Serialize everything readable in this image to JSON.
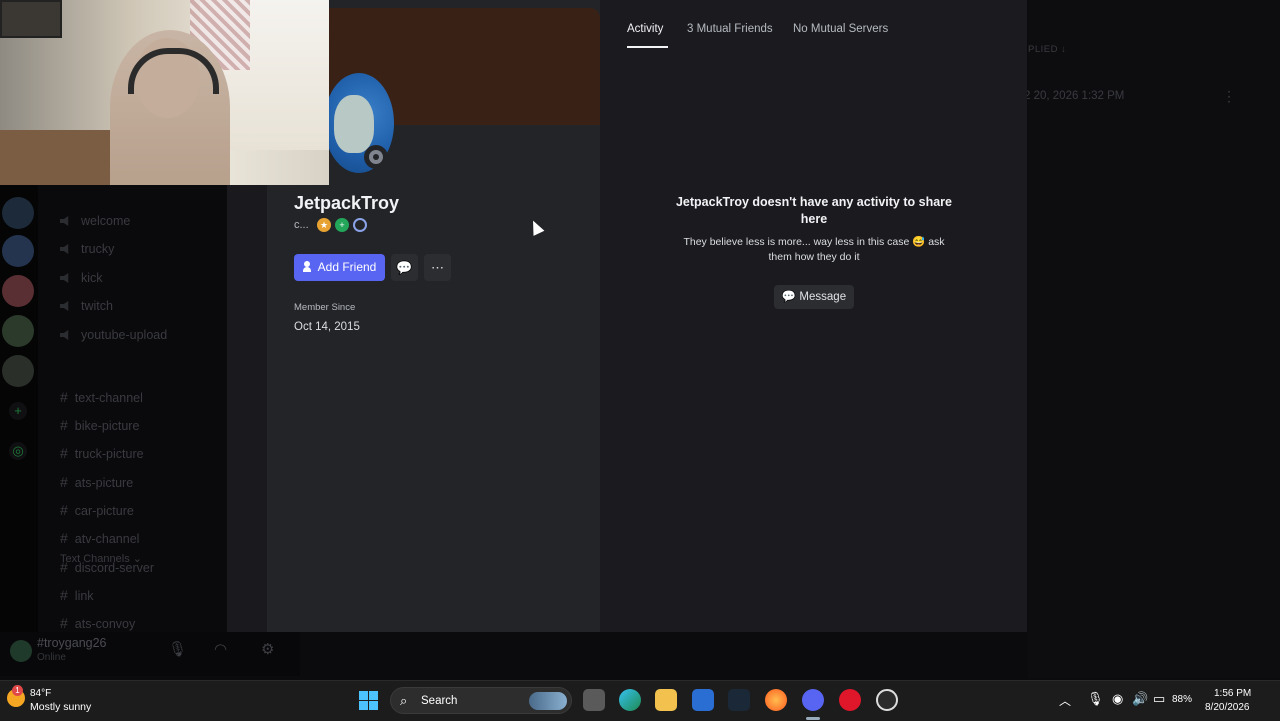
{
  "channels": {
    "voice": [
      "welcome",
      "trucky",
      "kick",
      "twitch",
      "youtube-upload"
    ],
    "category": "Text Channels",
    "text": [
      "text-channel",
      "bike-picture",
      "truck-picture",
      "ats-picture",
      "car-picture",
      "atv-channel",
      "discord-server",
      "link",
      "ats-convoy"
    ]
  },
  "userbar": {
    "name": "#troygang26",
    "status": "Online"
  },
  "background": {
    "replied_label": "PLIED",
    "message_date": "2 20, 2026 1:32 PM"
  },
  "profile": {
    "display_name": "JetpackTroy",
    "custom_status": "c...",
    "add_friend_label": "Add Friend",
    "member_since_label": "Member Since",
    "member_since_date": "Oct 14, 2015",
    "more_icon": "more-horizontal-icon",
    "status_color": "#80848e",
    "accent_color": "#5865f2",
    "banner_color": "#3a2116"
  },
  "tabs": [
    "Activity",
    "3 Mutual Friends",
    "No Mutual Servers"
  ],
  "activity": {
    "empty_title": "JetpackTroy doesn't have any activity to share here",
    "empty_subtitle": "They believe less is more... way less in this case 😅 ask them how they do it",
    "message_button": "Message"
  },
  "taskbar": {
    "weather_temp": "84°F",
    "weather_desc": "Mostly sunny",
    "weather_badge": "1",
    "search_label": "Search",
    "battery": "88%",
    "time": "1:56 PM",
    "date": "8/20/2026"
  }
}
